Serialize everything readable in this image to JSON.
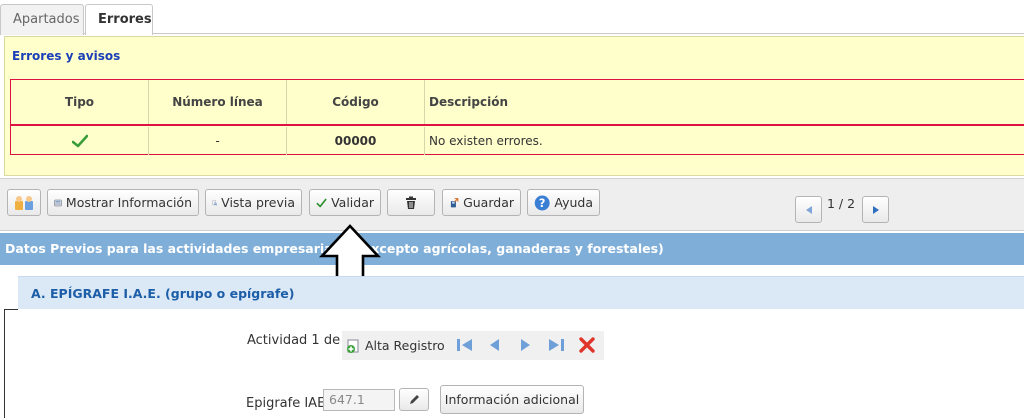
{
  "tabs": [
    {
      "label": "Apartados"
    },
    {
      "label": "Errores"
    }
  ],
  "errors": {
    "title": "Errores y avisos",
    "columns": [
      "Tipo",
      "Número línea",
      "Código",
      "Descripción"
    ],
    "rows": [
      {
        "tipo_icon": "green-check-icon",
        "linea": "-",
        "codigo": "00000",
        "descripcion": "No existen errores."
      }
    ]
  },
  "toolbar": {
    "mostrar_info": "Mostrar Información",
    "vista_previa": "Vista previa",
    "validar": "Validar",
    "guardar": "Guardar",
    "ayuda": "Ayuda",
    "pager": "1 / 2"
  },
  "section": {
    "title": "Datos Previos para las actividades empresariales (excepto agrícolas, ganaderas y forestales)",
    "subsection": "A. EPÍGRAFE I.A.E. (grupo o epígrafe)"
  },
  "form": {
    "actividad_label": "Actividad 1 de 1",
    "alta_registro": "Alta Registro",
    "epigrafe_label": "Epigrafe IAE",
    "epigrafe_value": "647.1",
    "info_adicional": "Información adicional"
  },
  "colors": {
    "panel_bg": "#ffffcc",
    "error_border": "#dd1144",
    "section_blue": "#7faed8",
    "subsection_bg": "#dbe9f7",
    "title_blue": "#1a3fb8"
  }
}
